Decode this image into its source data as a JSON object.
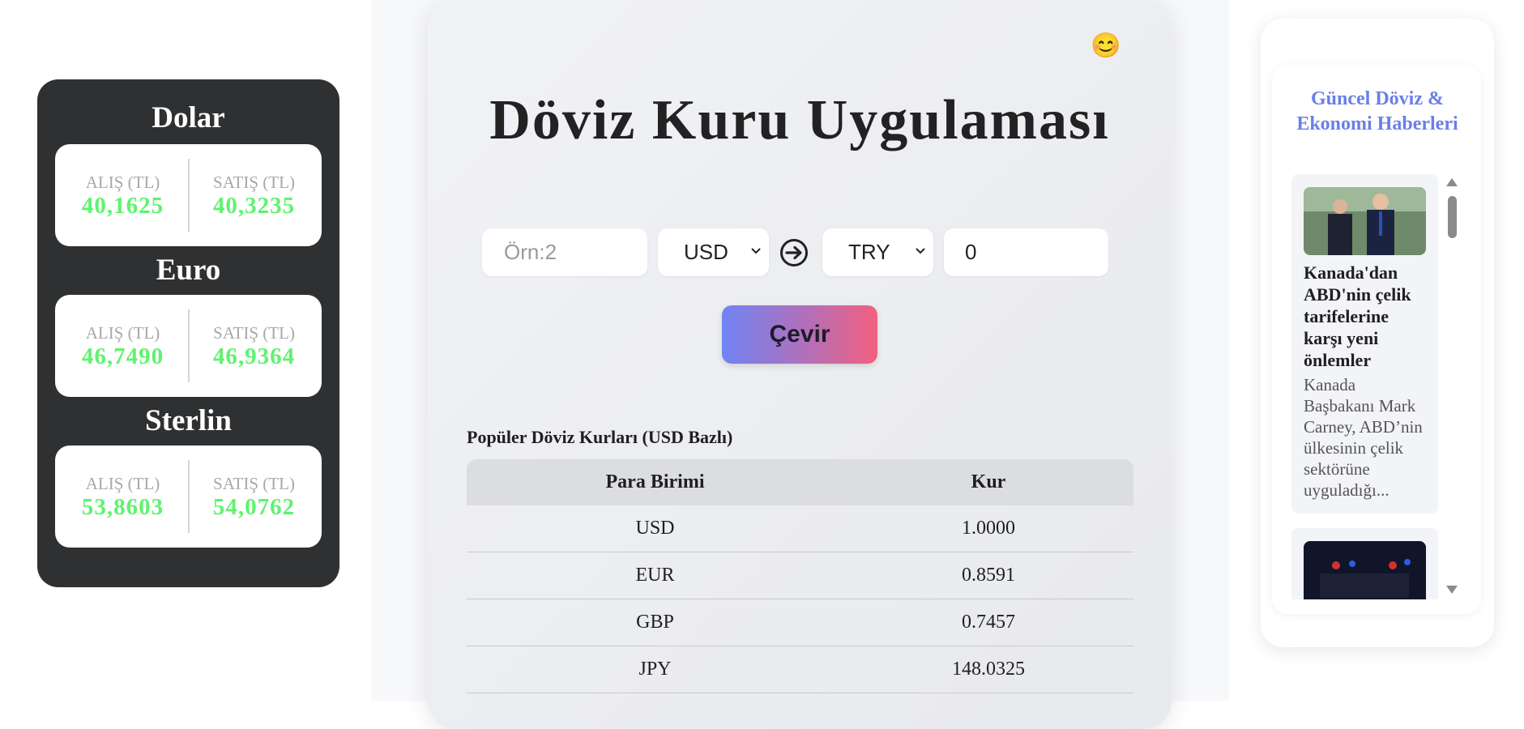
{
  "rates_sidebar": {
    "buy_label": "ALIŞ (TL)",
    "sell_label": "SATIŞ (TL)",
    "currencies": [
      {
        "name": "Dolar",
        "buy": "40,1625",
        "sell": "40,3235"
      },
      {
        "name": "Euro",
        "buy": "46,7490",
        "sell": "46,9364"
      },
      {
        "name": "Sterlin",
        "buy": "53,8603",
        "sell": "54,0762"
      }
    ]
  },
  "main": {
    "emoji": "😊",
    "title": "Döviz Kuru Uygulaması",
    "amount_placeholder": "Örn:2",
    "from_currency": "USD",
    "to_currency": "TRY",
    "result_value": "0",
    "convert_label": "Çevir",
    "table_caption": "Popüler Döviz Kurları (USD Bazlı)",
    "table_headers": [
      "Para Birimi",
      "Kur"
    ],
    "table_rows": [
      [
        "USD",
        "1.0000"
      ],
      [
        "EUR",
        "0.8591"
      ],
      [
        "GBP",
        "0.7457"
      ],
      [
        "JPY",
        "148.0325"
      ]
    ]
  },
  "news": {
    "heading": "Güncel Döviz & Ekonomi Haberleri",
    "items": [
      {
        "title": "Kanada'dan ABD'nin çelik tarifelerine karşı yeni önlemler",
        "description": "Kanada Başbakanı Mark Carney, ABD’nin ülkesinin çelik sektörüne uyguladığı..."
      }
    ]
  },
  "colors": {
    "panel_dark": "#2f3031",
    "rate_green": "#5ef36e",
    "news_heading": "#6a7fe8",
    "button_gradient_start": "#6f84f4",
    "button_gradient_end": "#f2607e"
  }
}
